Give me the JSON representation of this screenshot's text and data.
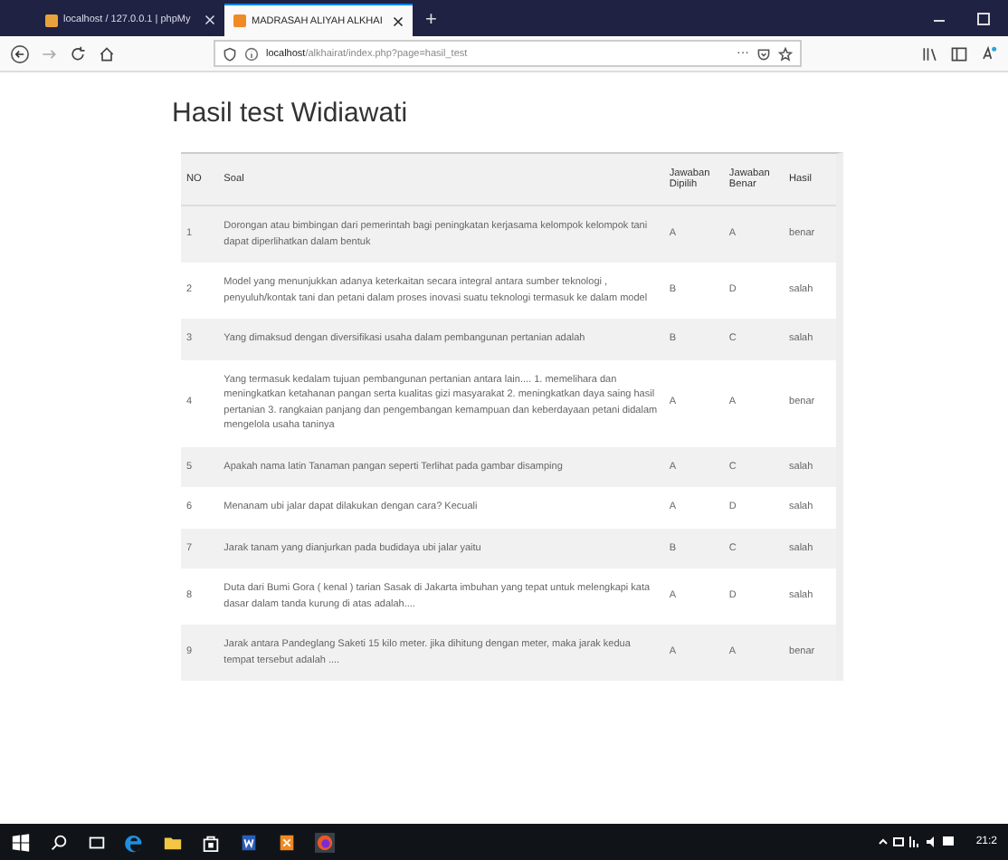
{
  "browser": {
    "tabs": [
      {
        "label": "localhost / 127.0.0.1 | phpMy",
        "selected": false
      },
      {
        "label": "MADRASAH ALIYAH ALKHAI",
        "selected": true
      }
    ],
    "new_tab": "+",
    "address": {
      "host": "localhost",
      "path": "/alkhairat/index.php?page=hasil_test"
    },
    "page_menu": "···"
  },
  "page": {
    "title": "Hasil test Widiawati",
    "table": {
      "columns": [
        "NO",
        "Soal",
        "Jawaban Dipilih",
        "Jawaban Benar",
        "Hasil"
      ],
      "rows": [
        {
          "no": "1",
          "soal": "Dorongan atau bimbingan dari pemerintah bagi peningkatan kerjasama kelompok kelompok tani dapat diperlihatkan dalam bentuk",
          "dipilih": "A",
          "benar": "A",
          "hasil": "benar"
        },
        {
          "no": "2",
          "soal": "Model yang menunjukkan adanya keterkaitan secara integral antara sumber teknologi , penyuluh/kontak tani dan petani dalam proses inovasi suatu teknologi termasuk ke dalam model",
          "dipilih": "B",
          "benar": "D",
          "hasil": "salah"
        },
        {
          "no": "3",
          "soal": "Yang dimaksud dengan diversifikasi usaha dalam pembangunan pertanian adalah",
          "dipilih": "B",
          "benar": "C",
          "hasil": "salah"
        },
        {
          "no": "4",
          "soal": "Yang termasuk kedalam tujuan pembangunan pertanian antara lain.... 1. memelihara dan meningkatkan ketahanan pangan serta kualitas gizi masyarakat 2. meningkatkan daya saing hasil pertanian 3. rangkaian panjang dan pengembangan kemampuan dan keberdayaan petani didalam mengelola usaha taninya",
          "dipilih": "A",
          "benar": "A",
          "hasil": "benar"
        },
        {
          "no": "5",
          "soal": "Apakah nama latin Tanaman pangan seperti Terlihat pada gambar disamping",
          "dipilih": "A",
          "benar": "C",
          "hasil": "salah"
        },
        {
          "no": "6",
          "soal": "Menanam ubi jalar dapat dilakukan dengan cara? Kecuali",
          "dipilih": "A",
          "benar": "D",
          "hasil": "salah"
        },
        {
          "no": "7",
          "soal": "Jarak tanam yang dianjurkan pada budidaya ubi jalar yaitu",
          "dipilih": "B",
          "benar": "C",
          "hasil": "salah"
        },
        {
          "no": "8",
          "soal": "Duta dari Bumi Gora ( kenal ) tarian Sasak di Jakarta imbuhan yang tepat untuk melengkapi kata dasar dalam tanda kurung di atas adalah....",
          "dipilih": "A",
          "benar": "D",
          "hasil": "salah"
        },
        {
          "no": "9",
          "soal": "Jarak antara Pandeglang Saketi 15 kilo meter. jika dihitung dengan meter, maka jarak kedua tempat tersebut adalah ....",
          "dipilih": "A",
          "benar": "A",
          "hasil": "benar"
        }
      ]
    }
  },
  "taskbar": {
    "clock": "21:2"
  }
}
